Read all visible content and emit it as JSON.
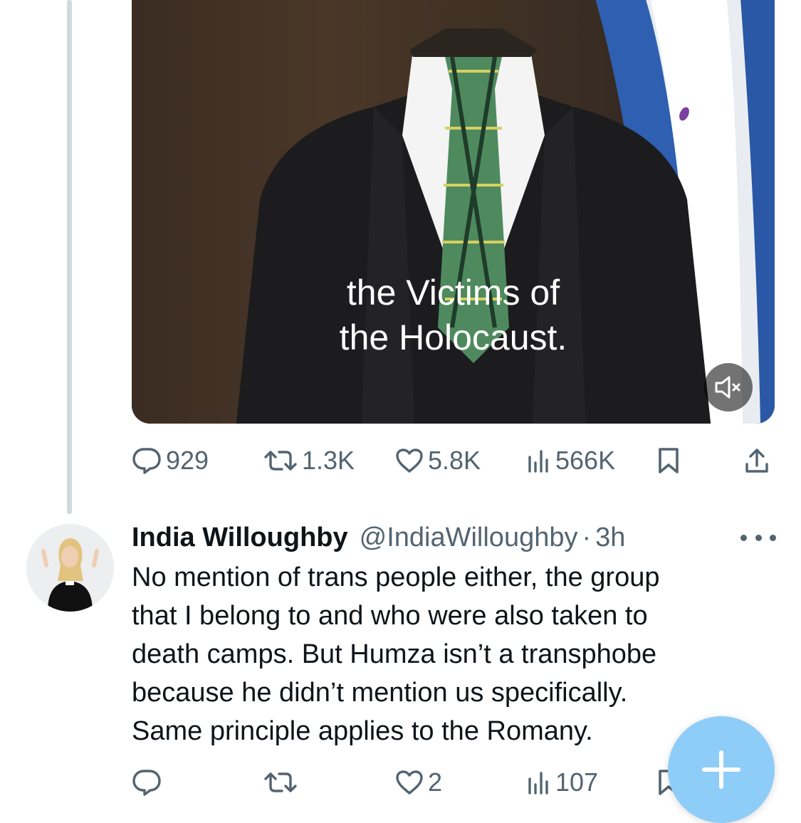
{
  "tweet": {
    "video": {
      "caption_line1": "the Victims of",
      "caption_line2": "the Holocaust."
    },
    "stats": {
      "replies": "929",
      "reposts": "1.3K",
      "likes": "5.8K",
      "views": "566K"
    }
  },
  "reply": {
    "name": "India Willoughby",
    "handle": "@IndiaWilloughby",
    "dot": "·",
    "time": "3h",
    "text_lines": [
      "No mention of trans people either, the group",
      "that I belong to and who were also taken to",
      "death camps. But Humza isn’t a transphobe",
      "because he didn’t mention us specifically.",
      "Same principle applies to the Romany."
    ],
    "stats": {
      "replies": "",
      "reposts": "",
      "likes": "2",
      "views": "107"
    }
  },
  "colors": {
    "text": "#0f1419",
    "muted": "#536471",
    "thread_line": "#cfd9de",
    "fab": "#8ecdf8"
  },
  "icons": [
    "reply-icon",
    "repost-icon",
    "like-icon",
    "views-icon",
    "bookmark-icon",
    "share-icon",
    "mute-icon",
    "more-icon",
    "compose-plus-icon"
  ]
}
